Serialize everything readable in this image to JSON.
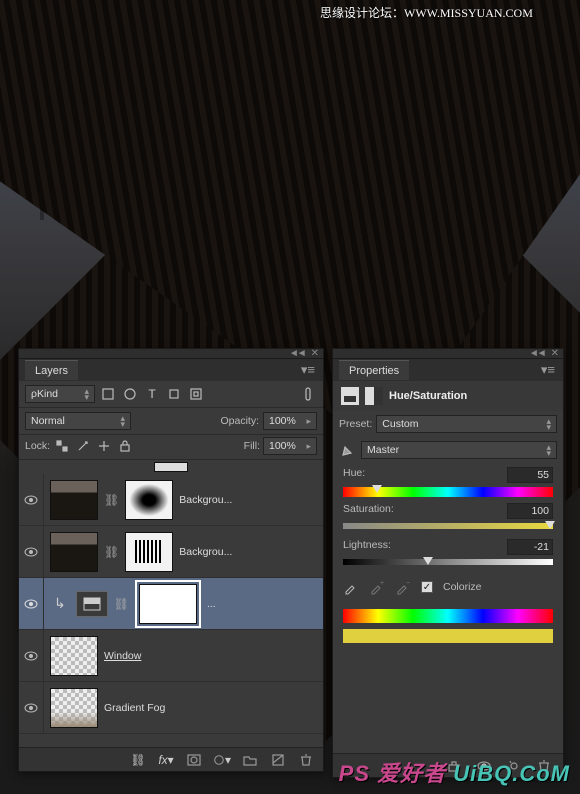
{
  "watermark_top": "思缘设计论坛：WWW.MISSYUAN.COM",
  "watermark_bottom_prefix": "PS 爱好者",
  "watermark_bottom": "UiBQ.CoM",
  "layers_panel": {
    "tab": "Layers",
    "filter_kind_label": "Kind",
    "blend_mode": "Normal",
    "opacity_label": "Opacity:",
    "opacity_value": "100%",
    "lock_label": "Lock:",
    "fill_label": "Fill:",
    "fill_value": "100%",
    "layers": [
      {
        "name": "Backgrou..."
      },
      {
        "name": "Backgrou..."
      },
      {
        "name": "..."
      },
      {
        "name": "Window "
      },
      {
        "name": "Gradient Fog"
      }
    ]
  },
  "props_panel": {
    "tab": "Properties",
    "title": "Hue/Saturation",
    "preset_label": "Preset:",
    "preset_value": "Custom",
    "channel_value": "Master",
    "hue_label": "Hue:",
    "hue_value": "55",
    "sat_label": "Saturation:",
    "sat_value": "100",
    "lig_label": "Lightness:",
    "lig_value": "-21",
    "colorize_label": "Colorize"
  }
}
